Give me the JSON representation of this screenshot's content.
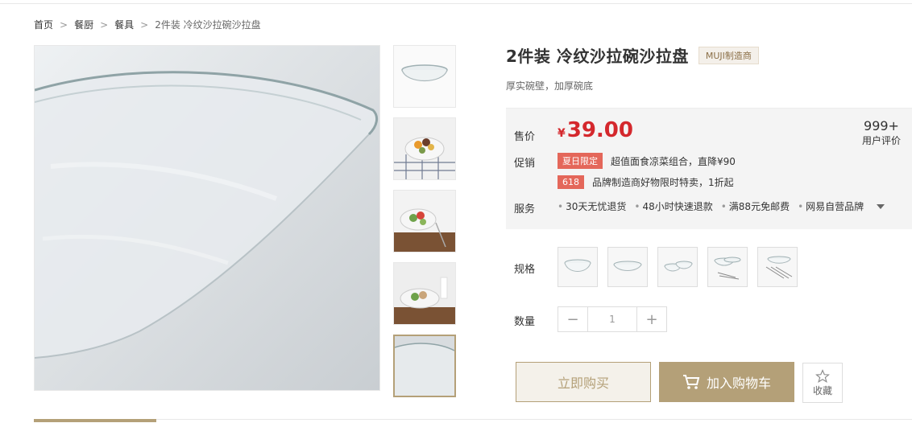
{
  "breadcrumb": {
    "items": [
      "首页",
      "餐厨",
      "餐具"
    ],
    "current": "2件装 冷纹沙拉碗沙拉盘"
  },
  "product": {
    "title": "2件装 冷纹沙拉碗沙拉盘",
    "maker_badge": "MUJI制造商",
    "subtitle": "厚实碗壁，加厚碗底"
  },
  "price": {
    "label": "售价",
    "currency": "¥",
    "value": "39.00",
    "color": "#d4282d"
  },
  "reviews": {
    "count": "999+",
    "label": "用户评价"
  },
  "promotion": {
    "label": "促销",
    "items": [
      {
        "tag": "夏日限定",
        "text": "超值面食凉菜组合，直降¥90"
      },
      {
        "tag": "618",
        "text": "品牌制造商好物限时特卖，1折起"
      }
    ]
  },
  "service": {
    "label": "服务",
    "items": [
      "30天无忧退货",
      "48小时快速退款",
      "满88元免邮费",
      "网易自营品牌"
    ]
  },
  "spec": {
    "label": "规格",
    "options": [
      "spec-option-1",
      "spec-option-2",
      "spec-option-3",
      "spec-option-4",
      "spec-option-5"
    ]
  },
  "quantity": {
    "label": "数量",
    "minus": "−",
    "value": "1",
    "plus": "+"
  },
  "actions": {
    "buy_now": "立即购买",
    "add_to_cart": "加入购物车",
    "favorite": "收藏"
  },
  "colors": {
    "accent": "#b4a078",
    "promo_tag": "#e4675a"
  }
}
